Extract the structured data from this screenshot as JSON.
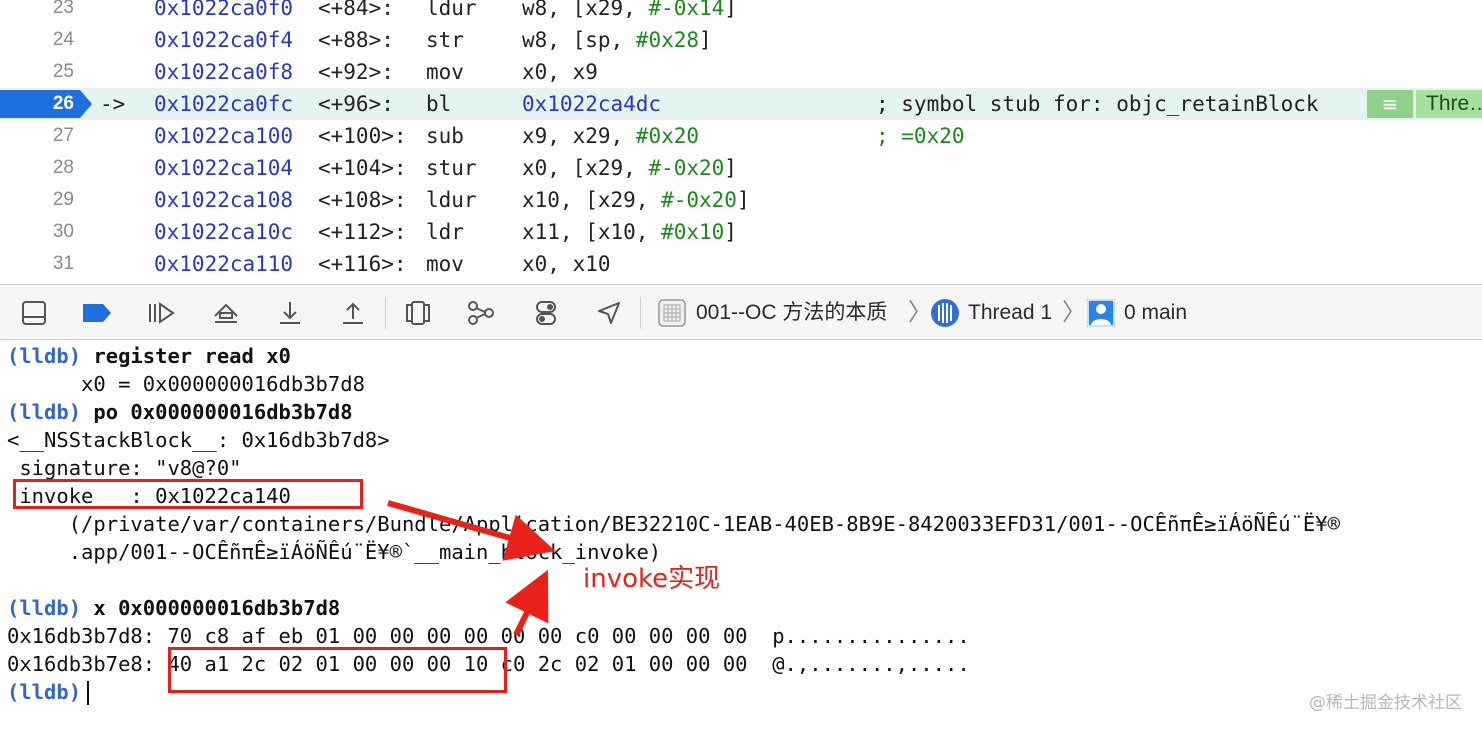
{
  "disassembly": {
    "rows": [
      {
        "line": "23",
        "address": "0x1022ca0f0",
        "offset": "<+84>:",
        "mnemonic": "ldur",
        "ops_pre": "w8, [x29, ",
        "ops_num": "#-0x14",
        "ops_post": "]"
      },
      {
        "line": "24",
        "address": "0x1022ca0f4",
        "offset": "<+88>:",
        "mnemonic": "str",
        "ops_pre": "w8, [sp, ",
        "ops_num": "#0x28",
        "ops_post": "]"
      },
      {
        "line": "25",
        "address": "0x1022ca0f8",
        "offset": "<+92>:",
        "mnemonic": "mov",
        "ops_pre": "x0, x9",
        "ops_num": "",
        "ops_post": ""
      },
      {
        "line": "26",
        "address": "0x1022ca0fc",
        "offset": "<+96>:",
        "mnemonic": "bl",
        "ops_pre": "0x1022ca4dc",
        "ops_num": "",
        "ops_post": ""
      },
      {
        "line": "27",
        "address": "0x1022ca100",
        "offset": "<+100>:",
        "mnemonic": "sub",
        "ops_pre": "x9, x29, ",
        "ops_num": "#0x20",
        "ops_post": ""
      },
      {
        "line": "28",
        "address": "0x1022ca104",
        "offset": "<+104>:",
        "mnemonic": "stur",
        "ops_pre": "x0, [x29, ",
        "ops_num": "#-0x20",
        "ops_post": "]"
      },
      {
        "line": "29",
        "address": "0x1022ca108",
        "offset": "<+108>:",
        "mnemonic": "ldur",
        "ops_pre": "x10, [x29, ",
        "ops_num": "#-0x20",
        "ops_post": "]"
      },
      {
        "line": "30",
        "address": "0x1022ca10c",
        "offset": "<+112>:",
        "mnemonic": "ldr",
        "ops_pre": "x11, [x10, ",
        "ops_num": "#0x10",
        "ops_post": "]"
      },
      {
        "line": "31",
        "address": "0x1022ca110",
        "offset": "<+116>:",
        "mnemonic": "mov",
        "ops_pre": "x0, x10",
        "ops_num": "",
        "ops_post": ""
      }
    ],
    "current_arrow": "->",
    "current_comment": "; symbol stub for: objc_retainBlock",
    "sub_comment": "; =0x20",
    "thread_badge": "Thre…"
  },
  "toolbar": {
    "icons": [
      "hide-debug-area-icon",
      "breakpoints-toggle-icon",
      "continue-icon",
      "step-over-icon",
      "step-into-icon",
      "step-out-icon",
      "view-hierarchy-icon",
      "memory-graph-icon",
      "environment-overrides-icon",
      "simulate-location-icon"
    ],
    "breadcrumb": {
      "project": "001--OC 方法的本质",
      "thread": "Thread 1",
      "frame": "0 main"
    }
  },
  "console": {
    "prompt": "(lldb)",
    "cmd1": "register read x0",
    "out1": "      x0 = 0x000000016db3b7d8",
    "cmd2": "po 0x000000016db3b7d8",
    "out2": "<__NSStackBlock__: 0x16db3b7d8>",
    "out3": " signature: \"v8@?0\"",
    "out4": " invoke   : 0x1022ca140",
    "out5": "     (/private/var/containers/Bundle/Application/BE32210C-1EAB-40EB-8B9E-8420033EFD31/001--OCÊñπÊ≥ïÁöÑÊú¨Ë¥®",
    "out6": "     .app/001--OCÊñπÊ≥ïÁöÑÊú¨Ë¥®`__main_block_invoke)",
    "cmd3": "x 0x000000016db3b7d8",
    "mem1": "0x16db3b7d8: 70 c8 af eb 01 00 00 00 00 00 00 c0 00 00 00 00  p...............",
    "mem2": "0x16db3b7e8: 40 a1 2c 02 01 00 00 00 10 c0 2c 02 01 00 00 00  @.,.......,....."
  },
  "annotation": {
    "label": "invoke实现",
    "color": "#e8221b"
  },
  "watermark": "@稀土掘金技术社区",
  "colors": {
    "address": "#2b37c6",
    "immediate": "#1b8a1b",
    "current_line": "#1f6fe0",
    "lldb_prompt": "#3366c9"
  }
}
